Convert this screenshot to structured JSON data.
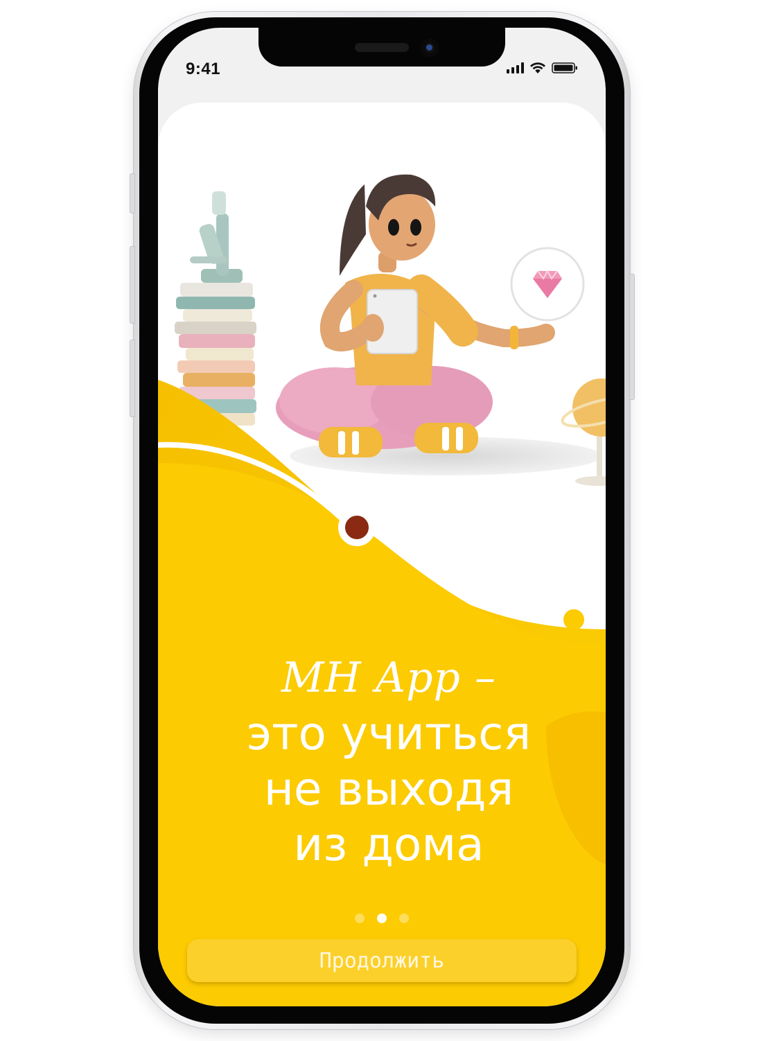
{
  "status_bar": {
    "time": "9:41",
    "icons": [
      "signal-icon",
      "wifi-icon",
      "battery-icon"
    ]
  },
  "onboarding": {
    "brand": "MH App –",
    "tagline_lines": [
      "это учиться",
      "не выходя",
      "из дома"
    ],
    "pager": {
      "total": 3,
      "active_index": 1
    },
    "continue_label": "Продолжить"
  },
  "colors": {
    "accent_yellow": "#fccc02",
    "deep_yellow": "#f5bd00",
    "marker_brown": "#8a2a12",
    "button": "#fcd02a"
  }
}
